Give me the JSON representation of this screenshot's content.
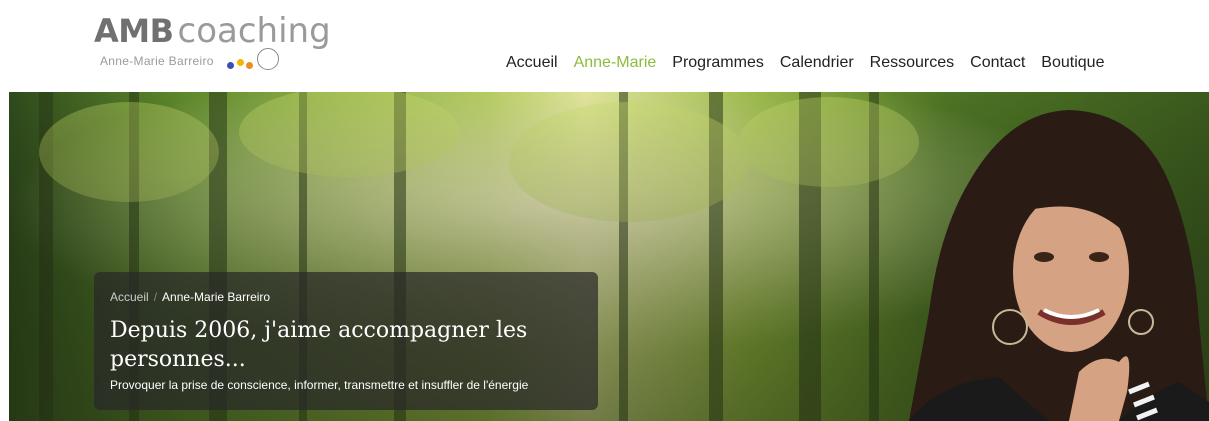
{
  "logo": {
    "brand": "AMB",
    "word": "coaching",
    "tagline": "Anne-Marie Barreiro",
    "colors": {
      "blue": "#3a4fb0",
      "yellow": "#f2b600",
      "orange": "#f08a24"
    }
  },
  "nav": {
    "items": [
      {
        "label": "Accueil"
      },
      {
        "label": "Anne-Marie",
        "active": true
      },
      {
        "label": "Programmes"
      },
      {
        "label": "Calendrier"
      },
      {
        "label": "Ressources"
      },
      {
        "label": "Contact"
      },
      {
        "label": "Boutique"
      }
    ],
    "active_color": "#8dbb3c"
  },
  "hero": {
    "breadcrumb": {
      "home": "Accueil",
      "separator": "/",
      "current": "Anne-Marie Barreiro"
    },
    "headline": "Depuis 2006, j'aime accompagner les personnes...",
    "subline": "Provoquer la prise de conscience, informer, transmettre et insuffler de l'énergie",
    "background": "forest-photo",
    "portrait": "woman-portrait-photo"
  }
}
